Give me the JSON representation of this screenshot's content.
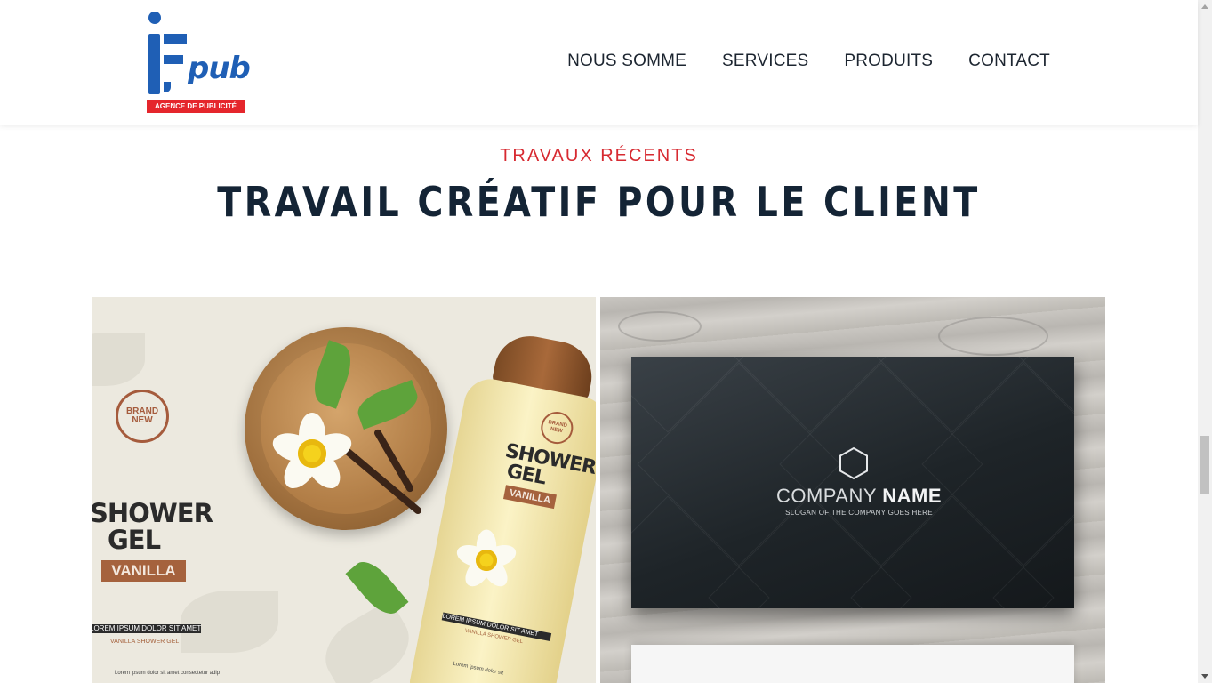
{
  "brand": {
    "name": "pub",
    "tagline": "AGENCE DE PUBLICITÉ",
    "colors": {
      "blue": "#1f5fb5",
      "red": "#e5262c"
    }
  },
  "nav": {
    "items": [
      {
        "label": "NOUS SOMME"
      },
      {
        "label": "SERVICES"
      },
      {
        "label": "PRODUITS"
      },
      {
        "label": "CONTACT"
      }
    ]
  },
  "section": {
    "eyebrow": "TRAVAUX RÉCENTS",
    "title": "TRAVAIL CRÉATIF POUR LE CLIENT",
    "accent_color": "#d72a31",
    "title_color": "#142435"
  },
  "portfolio": {
    "shower_gel": {
      "badge": "BRAND NEW",
      "title_line1": "SHOWER",
      "title_line2": "GEL",
      "flavor": "VANILLA",
      "lorem": "LOREM IPSUM DOLOR SIT AMET",
      "caption": "VANILLA SHOWER GEL",
      "small_text": "Lorem ipsum dolor sit amet consectetur adip",
      "bottle_badge": "BRAND NEW",
      "bottle_title_line1": "SHOWER",
      "bottle_title_line2": "GEL",
      "bottle_flavor": "VANILLA",
      "bottle_lorem": "LOREM IPSUM DOLOR SIT AMET",
      "bottle_caption": "VANILLA SHOWER GEL",
      "bottle_small_text": "Lorem ipsum dolor sit"
    },
    "business_card": {
      "company_light": "COMPANY",
      "company_bold": "NAME",
      "slogan": "SLOGAN OF THE COMPANY GOES HERE"
    }
  }
}
